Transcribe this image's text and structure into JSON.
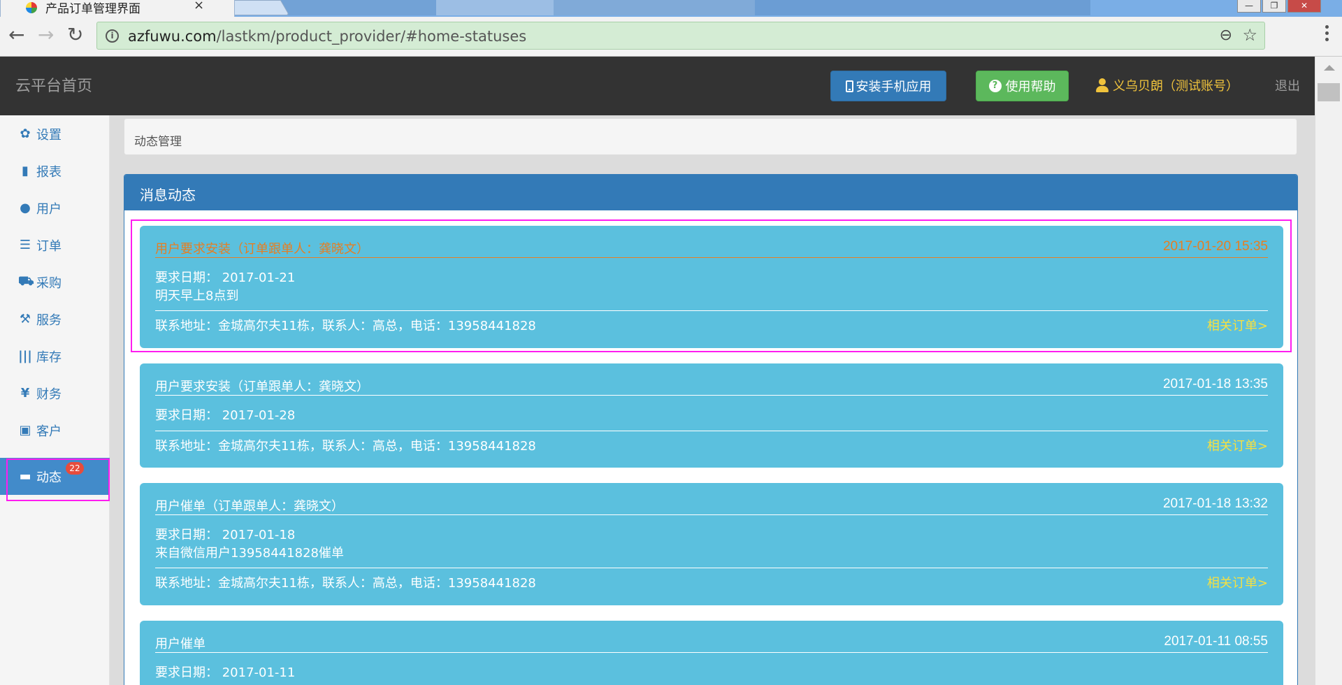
{
  "browser": {
    "tab_title": "产品订单管理界面",
    "tab_close": "×",
    "url_host": "azfuwu.com",
    "url_path": "/lastkm/product_provider/#home-statuses"
  },
  "header": {
    "brand": "云平台首页",
    "install_label": "安装手机应用",
    "help_label": "使用帮助",
    "user_label": "义乌贝朗（测试账号）",
    "logout_label": "退出"
  },
  "sidebar": {
    "items": [
      {
        "label": "设置",
        "icon": "gear-icon"
      },
      {
        "label": "报表",
        "icon": "bar-chart-icon"
      },
      {
        "label": "用户",
        "icon": "user-icon"
      },
      {
        "label": "订单",
        "icon": "list-icon"
      },
      {
        "label": "采购",
        "icon": "cart-icon"
      },
      {
        "label": "服务",
        "icon": "wrench-icon"
      },
      {
        "label": "库存",
        "icon": "barcode-icon"
      },
      {
        "label": "财务",
        "icon": "yen-icon"
      },
      {
        "label": "客户",
        "icon": "briefcase-icon"
      },
      {
        "label": "动态",
        "icon": "comment-icon",
        "badge": "22",
        "active": true
      }
    ]
  },
  "breadcrumb": "动态管理",
  "panel": {
    "title": "消息动态",
    "cards": [
      {
        "title": "用户要求安装（订单跟单人：龚晓文）",
        "time": "2017-01-20 15:35",
        "date_line": "要求日期：  2017-01-21",
        "note": "明天早上8点到",
        "contact": "联系地址：金城高尔夫11栋，联系人：高总，电话：13958441828",
        "link": "相关订单>"
      },
      {
        "title": "用户要求安装（订单跟单人：龚晓文）",
        "time": "2017-01-18 13:35",
        "date_line": "要求日期：  2017-01-28",
        "contact": "联系地址：金城高尔夫11栋，联系人：高总，电话：13958441828",
        "link": "相关订单>"
      },
      {
        "title": "用户催单（订单跟单人：龚晓文）",
        "time": "2017-01-18 13:32",
        "date_line": "要求日期：  2017-01-18",
        "note": "来自微信用户13958441828催单",
        "contact": "联系地址：金城高尔夫11栋，联系人：高总，电话：13958441828",
        "link": "相关订单>"
      },
      {
        "title": "用户催单",
        "time": "2017-01-11 08:55",
        "date_line": "要求日期：  2017-01-11"
      }
    ]
  },
  "colors": {
    "header_bg": "#333333",
    "primary": "#337ab7",
    "success": "#5cb85c",
    "card_bg": "#5bc0de",
    "alert_text": "#e67e22",
    "link_yellow": "#f5e042",
    "highlight": "#ff1cf0"
  }
}
